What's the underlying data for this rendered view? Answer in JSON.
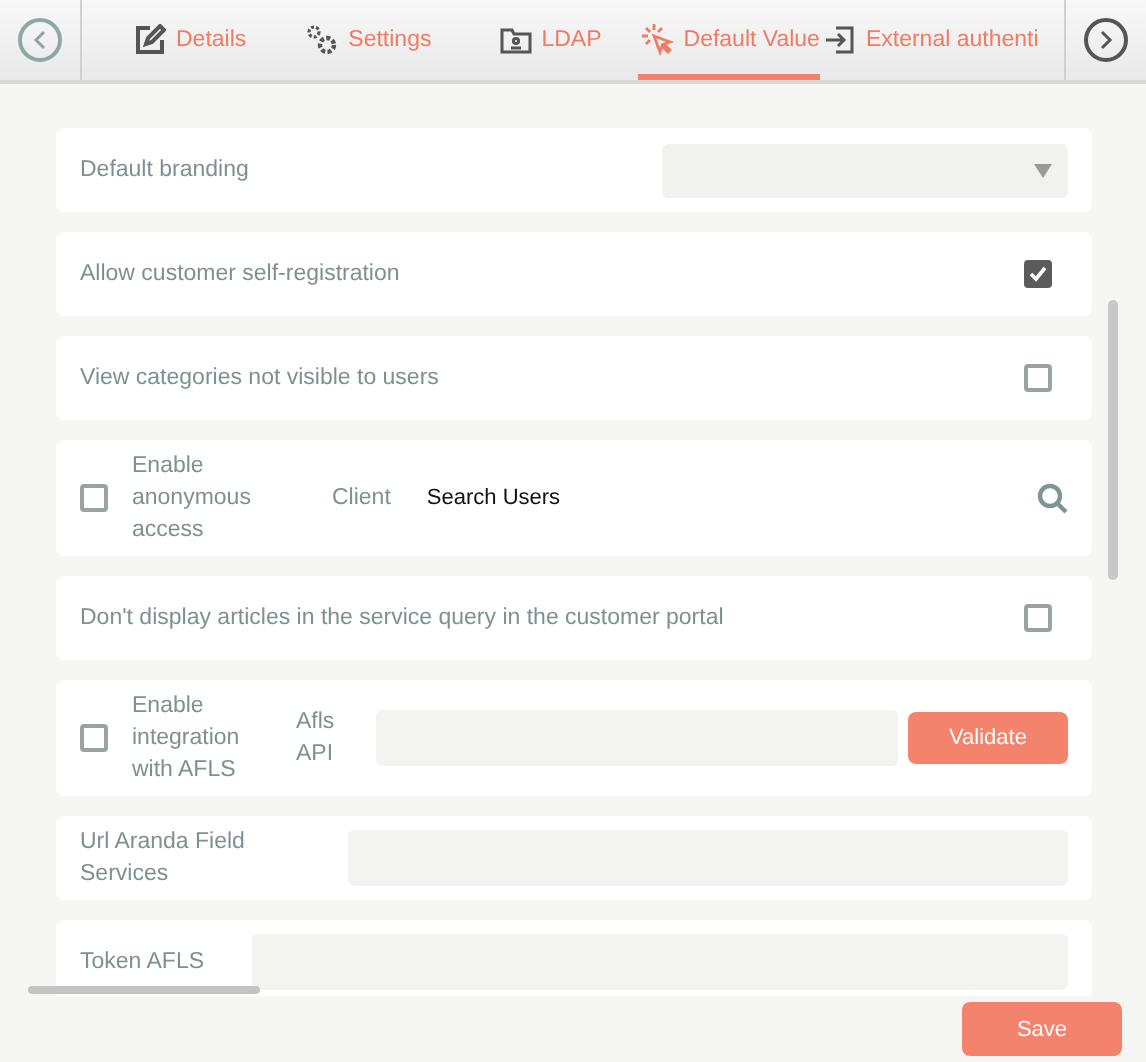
{
  "tabs": [
    {
      "label": "Details",
      "selected": false
    },
    {
      "label": "Settings",
      "selected": false
    },
    {
      "label": "LDAP",
      "selected": false
    },
    {
      "label": "Default Value",
      "selected": true
    },
    {
      "label": "External authenti",
      "selected": false
    }
  ],
  "rows": [
    {
      "kind": "select",
      "label": "Default branding"
    },
    {
      "kind": "checkbox",
      "label": "Allow customer self-registration",
      "checked": true
    },
    {
      "kind": "checkbox",
      "label": "View categories not visible to users",
      "checked": false
    },
    {
      "kind": "lookup",
      "label": "Enable anonymous access",
      "checked": false,
      "field_label": "Client",
      "value": "Search Users"
    },
    {
      "kind": "checkbox",
      "label": "Don't display articles in the service query in the customer portal",
      "checked": false
    },
    {
      "kind": "integration",
      "label": "Enable integration with AFLS",
      "checked": false,
      "field_label": "Afls API",
      "button": "Validate"
    },
    {
      "kind": "text",
      "label": "Url Aranda Field Services"
    },
    {
      "kind": "text",
      "label": "Token AFLS"
    }
  ],
  "save_button": "Save"
}
